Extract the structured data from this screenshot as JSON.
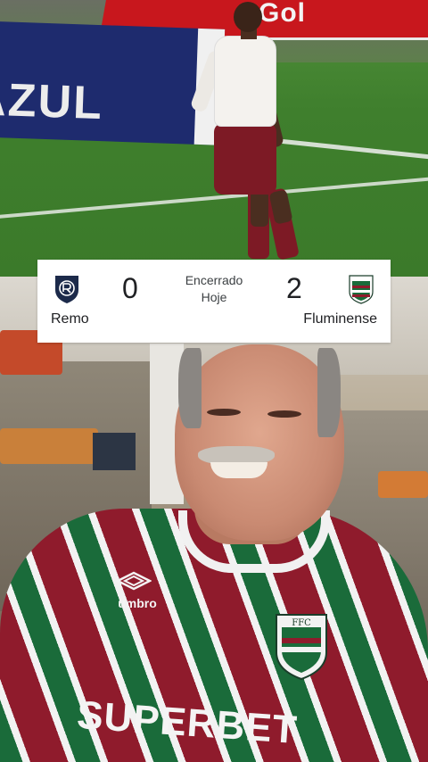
{
  "video_top": {
    "board_left_text": "AZUL",
    "board_right_text": "Gol"
  },
  "scoreboard": {
    "home_team": "Remo",
    "away_team": "Fluminense",
    "home_score": "0",
    "away_score": "2",
    "status_line1": "Encerrado",
    "status_line2": "Hoje",
    "home_crest_icon": "remo-crest-icon",
    "away_crest_icon": "fluminense-crest-icon",
    "colors": {
      "home_crest": "#1c2a4a",
      "away_crest_green": "#1a6b3a",
      "away_crest_red": "#8f1b2c"
    }
  },
  "video_bottom": {
    "shirt_brand": "umbro",
    "shirt_sponsor": "SUPERBET"
  }
}
